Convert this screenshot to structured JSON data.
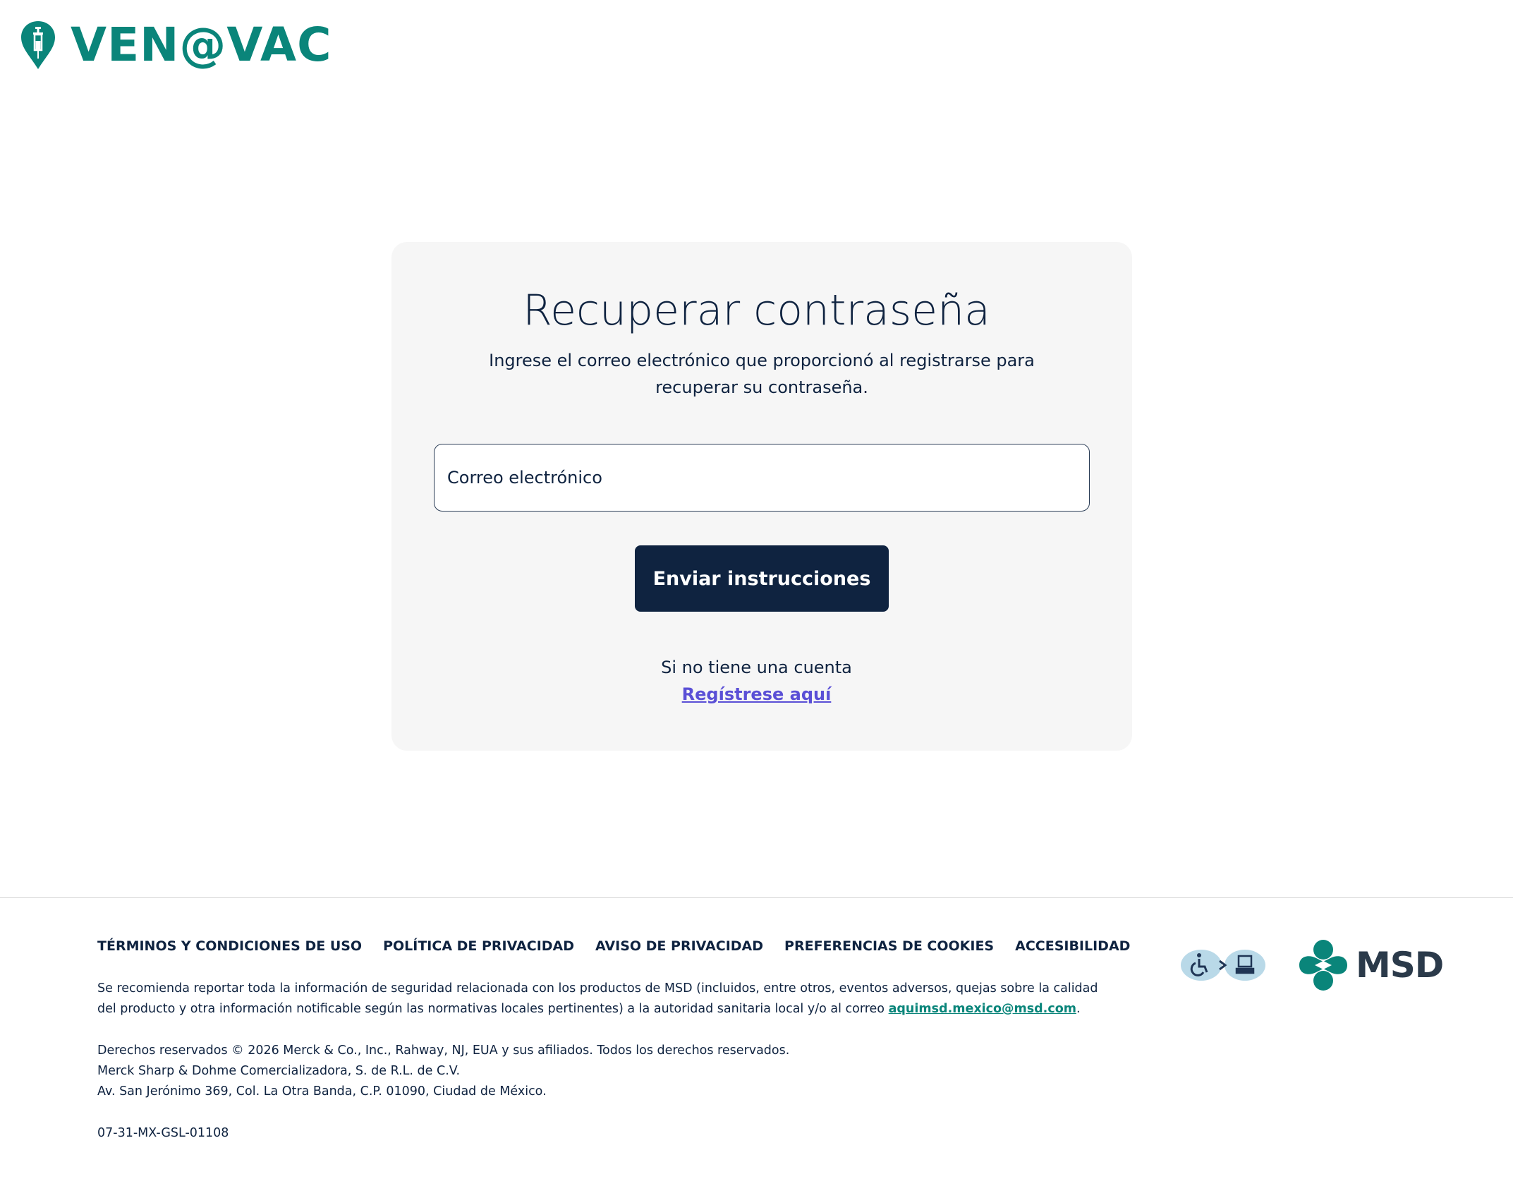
{
  "brand": {
    "logo_text": "VEN@VAC",
    "color": "#0a857a"
  },
  "card": {
    "title": "Recuperar contraseña",
    "subtitle": "Ingrese el correo electrónico que proporcionó al registrarse para recuperar su contraseña.",
    "email_placeholder": "Correo electrónico",
    "submit_label": "Enviar instrucciones",
    "no_account_text": "Si no tiene una cuenta",
    "register_link": "Regístrese aquí"
  },
  "footer": {
    "links": [
      "TÉRMINOS Y CONDICIONES DE USO",
      "POLÍTICA DE PRIVACIDAD",
      "AVISO DE PRIVACIDAD",
      "PREFERENCIAS DE COOKIES",
      "ACCESIBILIDAD"
    ],
    "report_text": "Se recomienda reportar toda la información de seguridad relacionada con los productos de MSD (incluidos, entre otros, eventos adversos, quejas sobre la calidad del producto y otra información notificable según las normativas locales pertinentes) a la autoridad sanitaria local y/o al correo ",
    "report_email": "aquimsd.mexico@msd.com",
    "report_end": ".",
    "rights_line1": "Derechos reservados © 2026 Merck & Co., Inc., Rahway, NJ, EUA y sus afiliados. Todos los derechos reservados.",
    "rights_line2": "Merck Sharp & Dohme Comercializadora, S. de R.L. de C.V.",
    "rights_line3": "Av. San Jerónimo 369, Col. La Otra Banda, C.P. 01090, Ciudad de México.",
    "code": "07-31-MX-GSL-01108",
    "msd_text": "MSD",
    "icons": [
      "accessibility-icon",
      "computer-icon",
      "msd-logo-mark"
    ]
  },
  "colors": {
    "navy": "#0f2340",
    "teal": "#0a857a",
    "link_purple": "#5a4fd6",
    "card_bg": "#f6f6f6"
  }
}
